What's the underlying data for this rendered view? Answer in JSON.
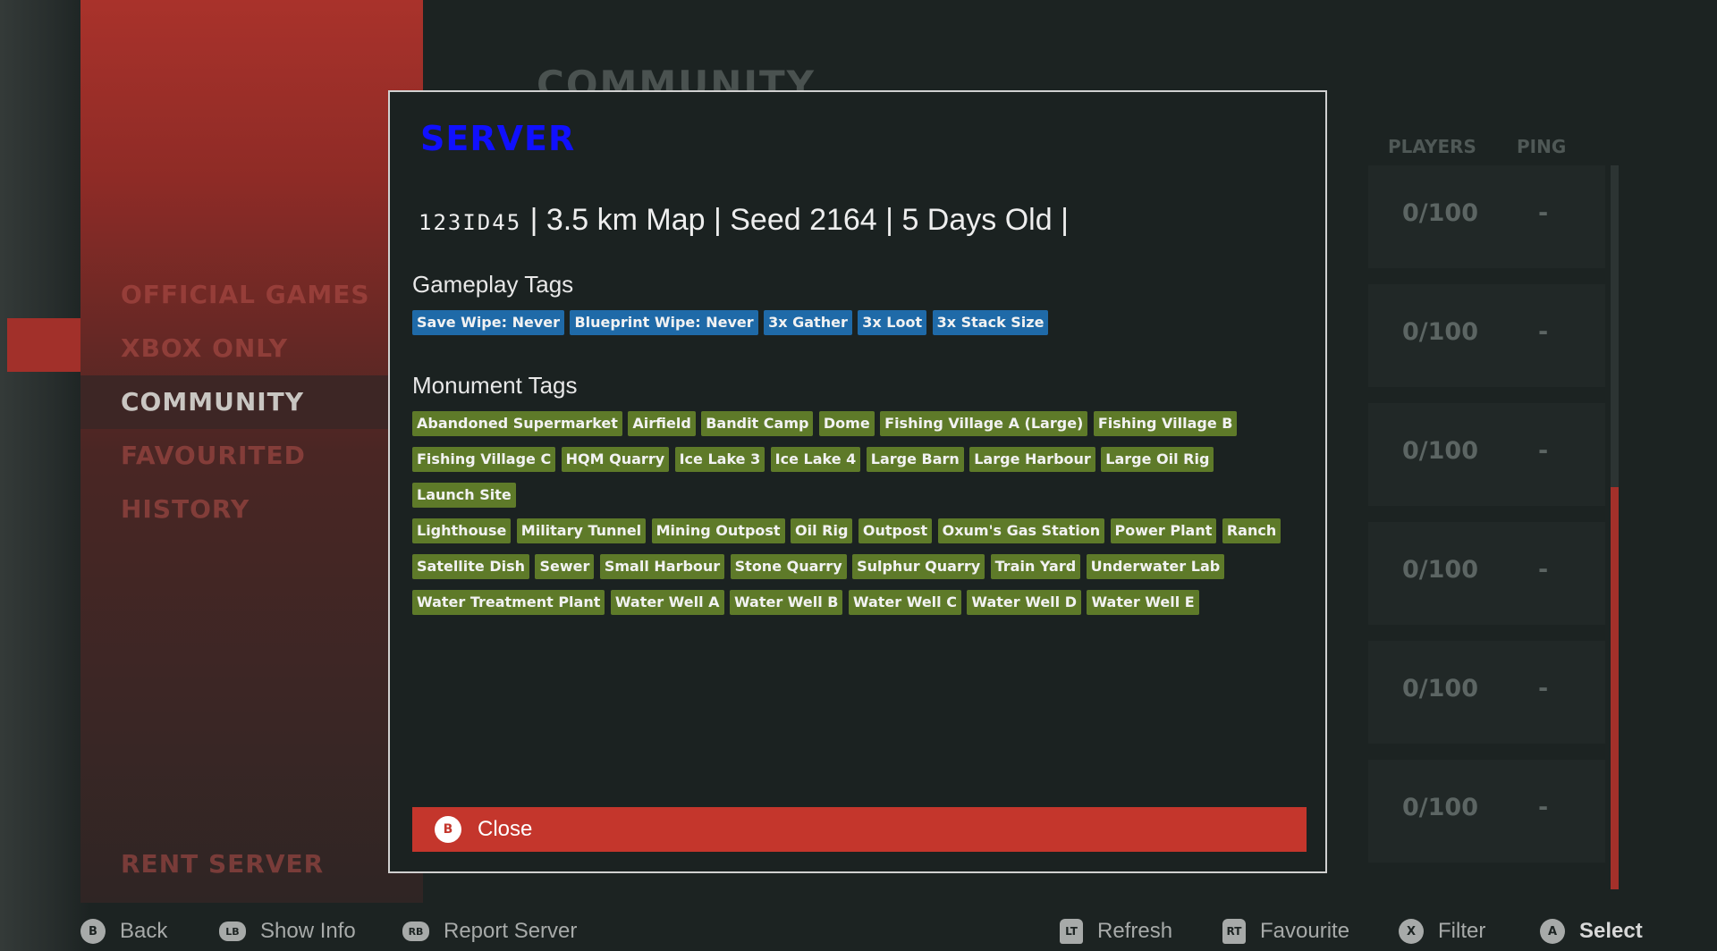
{
  "sidebar": {
    "items": [
      {
        "label": "OFFICIAL GAMES"
      },
      {
        "label": "XBOX ONLY"
      },
      {
        "label": "COMMUNITY"
      },
      {
        "label": "FAVOURITED"
      },
      {
        "label": "HISTORY"
      }
    ],
    "rent_server": "RENT SERVER"
  },
  "page": {
    "heading": "COMMUNITY",
    "columns": {
      "players": "PLAYERS",
      "ping": "PING"
    },
    "rows": [
      {
        "players": "0/100",
        "ping": "-"
      },
      {
        "players": "0/100",
        "ping": "-"
      },
      {
        "players": "0/100",
        "ping": "-"
      },
      {
        "players": "0/100",
        "ping": "-"
      },
      {
        "players": "0/100",
        "ping": "-"
      },
      {
        "players": "0/100",
        "ping": "-"
      }
    ]
  },
  "modal": {
    "title": "SERVER",
    "server_code": "123ID45",
    "server_details": "| 3.5 km Map | Seed 2164 | 5 Days Old |",
    "gameplay_heading": "Gameplay Tags",
    "gameplay_tags": [
      "Save Wipe: Never",
      "Blueprint Wipe: Never",
      "3x Gather",
      "3x Loot",
      "3x Stack Size"
    ],
    "monument_heading": "Monument Tags",
    "monument_tag_rows": [
      [
        "Abandoned Supermarket",
        "Airfield",
        "Bandit Camp",
        "Dome",
        "Fishing Village A (Large)",
        "Fishing Village B"
      ],
      [
        "Fishing Village C",
        "HQM Quarry",
        "Ice Lake 3",
        "Ice Lake 4",
        "Large Barn",
        "Large Harbour",
        "Large Oil Rig",
        "Launch Site"
      ],
      [
        "Lighthouse",
        "Military Tunnel",
        "Mining Outpost",
        "Oil Rig",
        "Outpost",
        "Oxum's Gas Station",
        "Power Plant",
        "Ranch"
      ],
      [
        "Satellite Dish",
        "Sewer",
        "Small Harbour",
        "Stone Quarry",
        "Sulphur Quarry",
        "Train Yard",
        "Underwater Lab"
      ],
      [
        "Water Treatment Plant",
        "Water Well A",
        "Water Well B",
        "Water Well C",
        "Water Well D",
        "Water Well E"
      ]
    ],
    "close": {
      "button_glyph": "B",
      "label": "Close"
    }
  },
  "footer": {
    "back": {
      "glyph": "B",
      "label": "Back"
    },
    "show_info": {
      "glyph": "LB",
      "label": "Show Info"
    },
    "report": {
      "glyph": "RB",
      "label": "Report Server"
    },
    "refresh": {
      "glyph": "LT",
      "label": "Refresh"
    },
    "favourite": {
      "glyph": "RT",
      "label": "Favourite"
    },
    "filter": {
      "glyph": "X",
      "label": "Filter"
    },
    "select": {
      "glyph": "A",
      "label": "Select"
    }
  },
  "colors": {
    "accent_red": "#c4362c",
    "title_blue": "#1010ff",
    "tag_blue": "#1f6aa8",
    "tag_green": "#5e7a29"
  }
}
